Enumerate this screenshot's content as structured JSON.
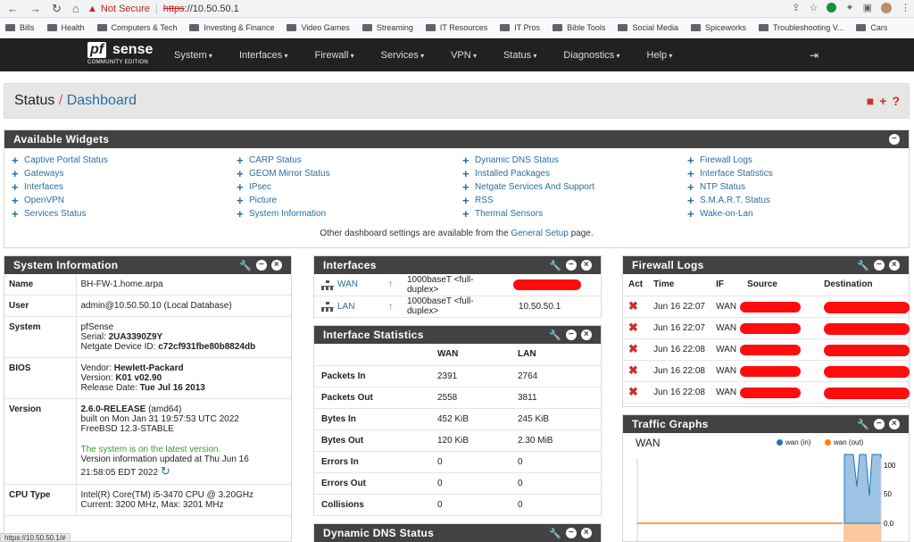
{
  "browser": {
    "not_secure": "Not Secure",
    "scheme": "https",
    "url_rest": "://10.50.50.1",
    "status_bar": "https://10.50.50.1/#"
  },
  "bookmarks": [
    "Bills",
    "Health",
    "Computers & Tech",
    "Investing & Finance",
    "Video Games",
    "Streaming",
    "IT Resources",
    "IT Pros",
    "Bible Tools",
    "Social Media",
    "Spiceworks",
    "Troubleshooting V...",
    "Cars"
  ],
  "nav": {
    "logo_pf": "pf",
    "logo_sense": "sense",
    "logo_sub": "COMMUNITY EDITION",
    "menu": [
      "System",
      "Interfaces",
      "Firewall",
      "Services",
      "VPN",
      "Status",
      "Diagnostics",
      "Help"
    ]
  },
  "crumb": {
    "status": "Status",
    "slash": "/",
    "dashboard": "Dashboard"
  },
  "available": {
    "title": "Available Widgets",
    "columns": [
      [
        "Captive Portal Status",
        "Gateways",
        "Interfaces",
        "OpenVPN",
        "Services Status"
      ],
      [
        "CARP Status",
        "GEOM Mirror Status",
        "IPsec",
        "Picture",
        "System Information"
      ],
      [
        "Dynamic DNS Status",
        "Installed Packages",
        "Netgate Services And Support",
        "RSS",
        "Thermal Sensors"
      ],
      [
        "Firewall Logs",
        "Interface Statistics",
        "NTP Status",
        "S.M.A.R.T. Status",
        "Wake-on-Lan"
      ]
    ],
    "footer_pre": "Other dashboard settings are available from the",
    "footer_link": "General Setup",
    "footer_post": "page."
  },
  "sysinfo": {
    "title": "System Information",
    "name_k": "Name",
    "name_v": "BH-FW-1.home.arpa",
    "user_k": "User",
    "user_v": "admin@10.50.50.10 (Local Database)",
    "system_k": "System",
    "system_v1": "pfSense",
    "system_v2_pre": "Serial: ",
    "system_v2": "2UA3390Z9Y",
    "system_v3_pre": "Netgate Device ID: ",
    "system_v3": "c72cf931fbe80b8824db",
    "bios_k": "BIOS",
    "bios_v1_pre": "Vendor: ",
    "bios_v1": "Hewlett-Packard",
    "bios_v2_pre": "Version: ",
    "bios_v2": "K01 v02.90",
    "bios_v3_pre": "Release Date: ",
    "bios_v3": "Tue Jul 16 2013",
    "version_k": "Version",
    "version_v1": "2.6.0-RELEASE",
    "version_v1b": " (amd64)",
    "version_v2": "built on Mon Jan 31 19:57:53 UTC 2022",
    "version_v3": "FreeBSD 12.3-STABLE",
    "version_v4": "The system is on the latest version.",
    "version_v5": "Version information updated at Thu Jun 16",
    "version_v6": "21:58:05 EDT 2022",
    "cpu_k": "CPU Type",
    "cpu_v1": "Intel(R) Core(TM) i5-3470 CPU @ 3.20GHz",
    "cpu_v2": "Current: 3200 MHz, Max: 3201 MHz"
  },
  "interfaces": {
    "title": "Interfaces",
    "rows": [
      {
        "name": "WAN",
        "media": "1000baseT <full-duplex>",
        "ip": ""
      },
      {
        "name": "LAN",
        "media": "1000baseT <full-duplex>",
        "ip": "10.50.50.1"
      }
    ]
  },
  "ifstats": {
    "title": "Interface Statistics",
    "cols": [
      "WAN",
      "LAN"
    ],
    "rows": [
      {
        "k": "Packets In",
        "wan": "2391",
        "lan": "2764"
      },
      {
        "k": "Packets Out",
        "wan": "2558",
        "lan": "3811"
      },
      {
        "k": "Bytes In",
        "wan": "452 KiB",
        "lan": "245 KiB"
      },
      {
        "k": "Bytes Out",
        "wan": "120 KiB",
        "lan": "2.30 MiB"
      },
      {
        "k": "Errors In",
        "wan": "0",
        "lan": "0"
      },
      {
        "k": "Errors Out",
        "wan": "0",
        "lan": "0"
      },
      {
        "k": "Collisions",
        "wan": "0",
        "lan": "0"
      }
    ]
  },
  "ddns": {
    "title": "Dynamic DNS Status"
  },
  "fwlogs": {
    "title": "Firewall Logs",
    "cols": [
      "Act",
      "Time",
      "IF",
      "Source",
      "Destination"
    ],
    "rows": [
      {
        "time": "Jun 16 22:07",
        "if": "WAN"
      },
      {
        "time": "Jun 16 22:07",
        "if": "WAN"
      },
      {
        "time": "Jun 16 22:08",
        "if": "WAN"
      },
      {
        "time": "Jun 16 22:08",
        "if": "WAN"
      },
      {
        "time": "Jun 16 22:08",
        "if": "WAN"
      }
    ]
  },
  "traffic": {
    "title": "Traffic Graphs",
    "iface": "WAN",
    "legend_in": "wan (in)",
    "legend_out": "wan (out)",
    "ticks": [
      "100",
      "50",
      "0.0"
    ],
    "in_color": "#1f77b4",
    "out_color": "#ff7f0e"
  }
}
